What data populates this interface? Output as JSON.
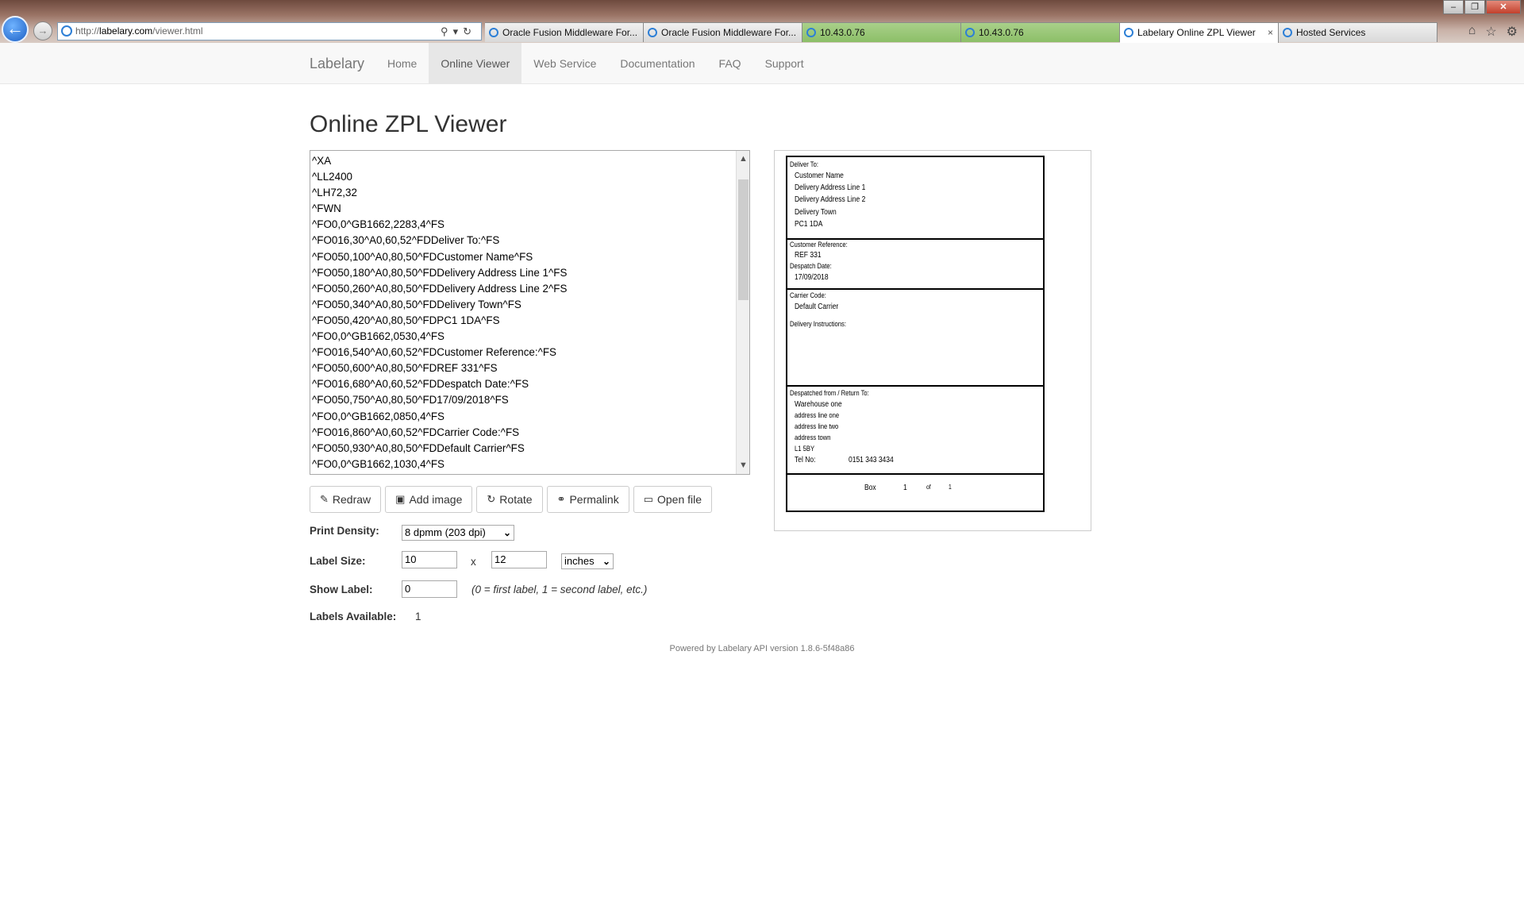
{
  "browser": {
    "address_prefix": "http://",
    "address_host": "labelary.com",
    "address_path": "/viewer.html",
    "tabs": [
      {
        "title": "Oracle Fusion Middleware For...",
        "style": "normal"
      },
      {
        "title": "Oracle Fusion Middleware For...",
        "style": "normal"
      },
      {
        "title": "10.43.0.76",
        "style": "green"
      },
      {
        "title": "10.43.0.76",
        "style": "green"
      },
      {
        "title": "Labelary Online ZPL Viewer",
        "style": "active"
      },
      {
        "title": "Hosted Services",
        "style": "normal"
      }
    ],
    "tab_close": "×",
    "window_buttons": {
      "minimize": "–",
      "restore": "❐",
      "close": "✕"
    },
    "icons": [
      "home-icon",
      "favorites-icon",
      "settings-icon"
    ]
  },
  "nav": {
    "brand": "Labelary",
    "items": [
      "Home",
      "Online Viewer",
      "Web Service",
      "Documentation",
      "FAQ",
      "Support"
    ],
    "active": "Online Viewer"
  },
  "main": {
    "title": "Online ZPL Viewer",
    "zpl_lines": [
      "^XA",
      "^LL2400",
      "^LH72,32",
      "^FWN",
      "^FO0,0^GB1662,2283,4^FS",
      "^FO016,30^A0,60,52^FDDeliver To:^FS",
      "^FO050,100^A0,80,50^FDCustomer Name^FS",
      "^FO050,180^A0,80,50^FDDelivery Address Line 1^FS",
      "^FO050,260^A0,80,50^FDDelivery Address Line 2^FS",
      "^FO050,340^A0,80,50^FDDelivery Town^FS",
      "^FO050,420^A0,80,50^FDPC1 1DA^FS",
      "^FO0,0^GB1662,0530,4^FS",
      "^FO016,540^A0,60,52^FDCustomer Reference:^FS",
      "^FO050,600^A0,80,50^FDREF 331^FS",
      "^FO016,680^A0,60,52^FDDespatch Date:^FS",
      "^FO050,750^A0,80,50^FD17/09/2018^FS",
      "^FO0,0^GB1662,0850,4^FS",
      "^FO016,860^A0,60,52^FDCarrier Code:^FS",
      "^FO050,930^A0,80,50^FDDefault Carrier^FS",
      "^FO0,0^GB1662,1030,4^FS"
    ],
    "buttons": [
      {
        "label": "Redraw",
        "icon": "✎",
        "icon_name": "edit-icon"
      },
      {
        "label": "Add image",
        "icon": "▣",
        "icon_name": "image-icon"
      },
      {
        "label": "Rotate",
        "icon": "↻",
        "icon_name": "rotate-icon"
      },
      {
        "label": "Permalink",
        "icon": "⚭",
        "icon_name": "link-icon"
      },
      {
        "label": "Open file",
        "icon": "▭",
        "icon_name": "folder-open-icon"
      }
    ],
    "print_density_label": "Print Density:",
    "print_density_value": "8 dpmm (203 dpi)",
    "label_size_label": "Label Size:",
    "label_width": "10",
    "label_size_x": "x",
    "label_height": "12",
    "label_units": "inches",
    "show_label_label": "Show Label:",
    "show_label_value": "0",
    "show_label_hint": "(0 = first label, 1 = second label, etc.)",
    "labels_available_label": "Labels Available:",
    "labels_available_value": "1",
    "footer": "Powered by Labelary API version 1.8.6-5f48a86"
  },
  "label_preview": {
    "deliver_to_title": "Deliver To:",
    "deliver_to_lines": [
      "Customer Name",
      "Delivery Address Line 1",
      "Delivery Address Line 2",
      "Delivery Town",
      "PC1 1DA"
    ],
    "customer_reference_title": "Customer Reference:",
    "customer_reference": "REF 331",
    "despatch_date_title": "Despatch Date:",
    "despatch_date": "17/09/2018",
    "carrier_code_title": "Carrier Code:",
    "carrier_code": "Default Carrier",
    "delivery_instructions_title": "Delivery Instructions:",
    "return_title": "Despatched from / Return To:",
    "return_lines": [
      "Warehouse one",
      "address line one",
      "address line two",
      "address town",
      "L1 5BY"
    ],
    "tel_label": "Tel No:",
    "tel_value": "0151 343 3434",
    "box_label": "Box",
    "box_number": "1",
    "box_of": "of",
    "box_total": "1"
  }
}
